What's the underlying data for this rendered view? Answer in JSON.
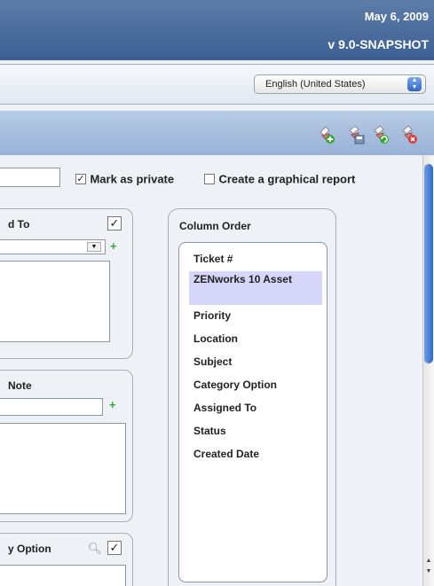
{
  "header": {
    "date": "May 6, 2009",
    "version": "v 9.0-SNAPSHOT"
  },
  "language": {
    "selected": "English (United States)"
  },
  "toolbar": {
    "icons": [
      "add-report-icon",
      "save-report-icon",
      "refresh-report-icon",
      "delete-report-icon"
    ]
  },
  "options": {
    "private_label": "Mark as private",
    "private_checked": true,
    "graph_label": "Create a graphical report",
    "graph_checked": false
  },
  "panels": {
    "assigned_title": "d To",
    "note_title": "Note",
    "category_title": "y Option"
  },
  "column_order": {
    "title": "Column Order",
    "items": [
      {
        "label": "Ticket #",
        "selected": false
      },
      {
        "label": "ZENworks 10 Asset",
        "selected": true
      },
      {
        "label": "Priority",
        "selected": false
      },
      {
        "label": "Location",
        "selected": false
      },
      {
        "label": "Subject",
        "selected": false
      },
      {
        "label": "Category Option",
        "selected": false
      },
      {
        "label": "Assigned To",
        "selected": false
      },
      {
        "label": "Status",
        "selected": false
      },
      {
        "label": "Created Date",
        "selected": false
      }
    ]
  },
  "colors": {
    "header": "#3b5f92",
    "toolbar": "#a9c0e0",
    "selection": "#d6d6fb",
    "accent": "#2f69c9"
  }
}
